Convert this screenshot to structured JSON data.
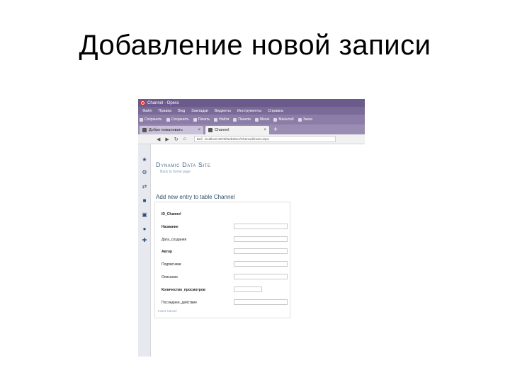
{
  "slide": {
    "title": "Добавление новой записи"
  },
  "browser": {
    "window_title": "Channel - Opera",
    "menu": [
      "Файл",
      "Правка",
      "Вид",
      "Закладки",
      "Виджеты",
      "Инструменты",
      "Справка"
    ],
    "bookmarks": [
      "Сохранить",
      "Сохранить",
      "Печать",
      "Найти",
      "Панели",
      "Меню",
      "Масштаб",
      "Заказ"
    ],
    "tabs": [
      {
        "label": "Добро пожаловать",
        "active": false
      },
      {
        "label": "Channel",
        "active": true
      }
    ],
    "tab_add": "+",
    "nav": {
      "back": "◀",
      "forward": "▶",
      "reload": "↻",
      "home": "⌂"
    },
    "url_prefix": "Веб",
    "url": "localhost:4978/WebSite1/Channel/Insert.aspx"
  },
  "page": {
    "site_title": "Dynamic Data Site",
    "back_link": "Back to home page",
    "form_heading": "Add new entry to table Channel",
    "fields": [
      {
        "label": "ID_Channel",
        "bold": true,
        "input": "none"
      },
      {
        "label": "Название",
        "bold": true,
        "input": "wide"
      },
      {
        "label": "Дата_создания",
        "bold": false,
        "input": "wide"
      },
      {
        "label": "Автор",
        "bold": true,
        "input": "wide"
      },
      {
        "label": "Подписчики",
        "bold": false,
        "input": "wide"
      },
      {
        "label": "Описание",
        "bold": false,
        "input": "wide"
      },
      {
        "label": "Количество_просмотров",
        "bold": true,
        "input": "narrow"
      },
      {
        "label": "Последнее_действие",
        "bold": false,
        "input": "wide"
      }
    ],
    "links": "Insert Cancel"
  }
}
